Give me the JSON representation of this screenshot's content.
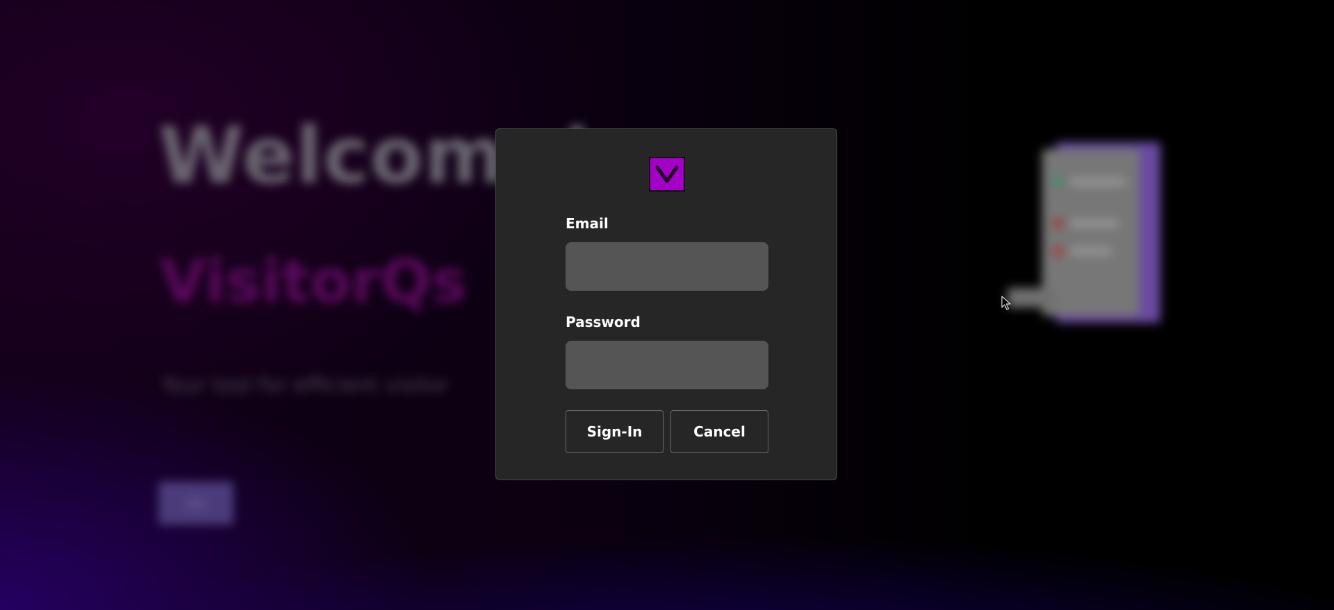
{
  "background": {
    "heading": "Welcome!",
    "brand": "VisitorQs",
    "tagline": "Your tool for efficient visitor",
    "button_label": "Go"
  },
  "modal": {
    "logo_letter": "V",
    "email": {
      "label": "Email",
      "value": "",
      "placeholder": ""
    },
    "password": {
      "label": "Password",
      "value": "",
      "placeholder": ""
    },
    "signin_label": "Sign-In",
    "cancel_label": "Cancel"
  },
  "colors": {
    "logo_bg": "#a400c8",
    "modal_bg": "#262626",
    "input_bg": "#555555",
    "brand_purple": "#5a0a5c"
  },
  "icons": {
    "logo": "v-logo-icon",
    "cursor": "mouse-pointer-icon"
  }
}
